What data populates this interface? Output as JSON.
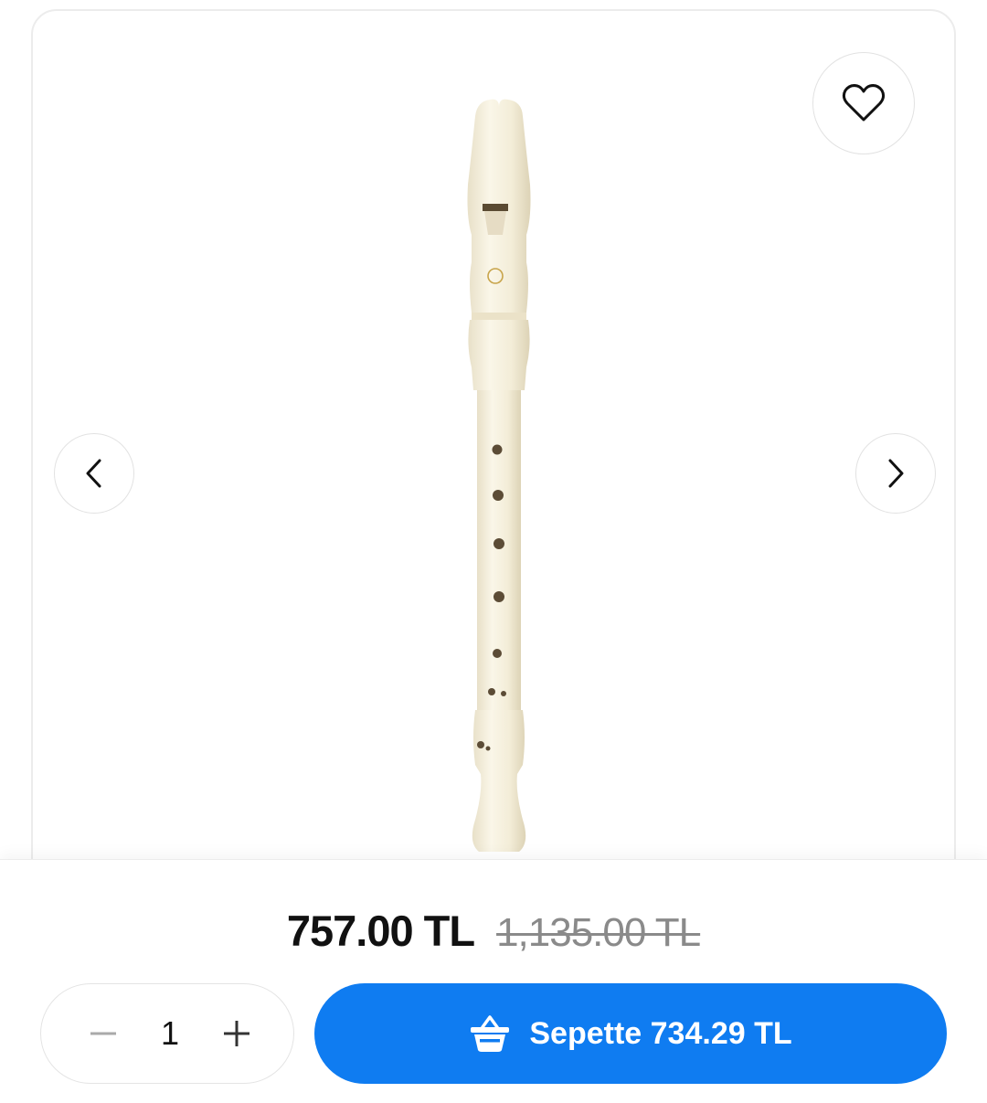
{
  "product": {
    "image_alt": "Recorder flute",
    "favorite_icon": "heart-icon",
    "prev_icon": "chevron-left-icon",
    "next_icon": "chevron-right-icon"
  },
  "pricing": {
    "current_price": "757.00 TL",
    "old_price": "1,135.00 TL"
  },
  "quantity": {
    "value": "1",
    "decrement_icon": "minus-icon",
    "increment_icon": "plus-icon"
  },
  "cart_button": {
    "label": "Sepette 734.29 TL",
    "icon": "basket-icon",
    "color": "#0f7cf1"
  }
}
